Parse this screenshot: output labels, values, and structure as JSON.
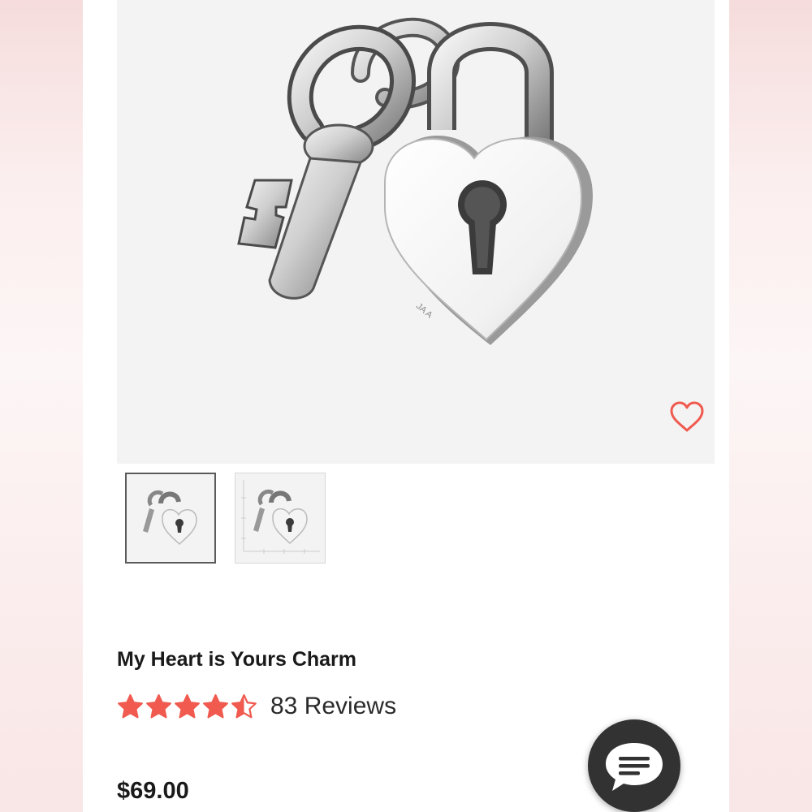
{
  "product": {
    "title": "My Heart is Yours Charm",
    "rating": 4.5,
    "reviews_label": "83 Reviews",
    "price": "$69.00"
  },
  "gallery": {
    "main_image": "heart-lock-with-key-charm-photo",
    "thumbnails": [
      {
        "image": "heart-lock-with-key-charm-thumbnail",
        "selected": true
      },
      {
        "image": "heart-lock-charm-with-size-guide-thumbnail",
        "selected": false
      }
    ]
  },
  "icons": {
    "wishlist": "heart-outline-icon",
    "chat": "chat-bubble-icon",
    "star": "star-icon"
  },
  "colors": {
    "accent": "#f05a4f",
    "text": "#1a1a1a",
    "chat_bg": "#323232"
  }
}
